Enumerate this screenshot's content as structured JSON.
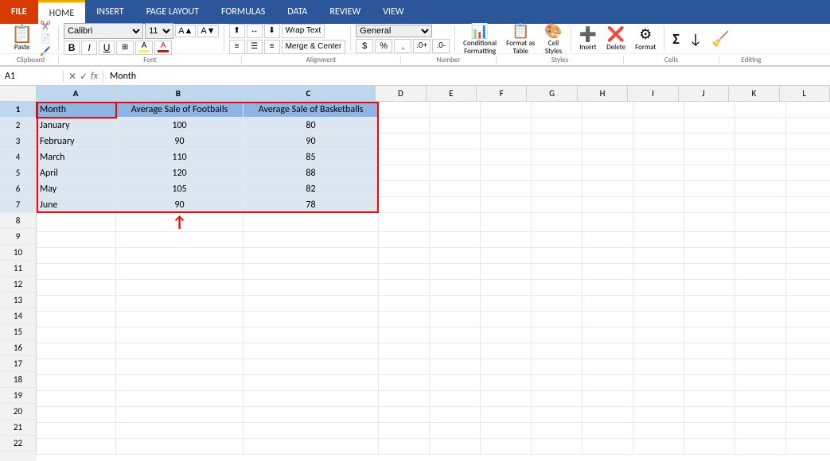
{
  "tabs": {
    "file": "FILE",
    "home": "HOME",
    "insert": "INSERT",
    "page_layout": "PAGE LAYOUT",
    "formulas": "FORMULAS",
    "data": "DATA",
    "review": "REVIEW",
    "view": "VIEW",
    "active": "HOME"
  },
  "toolbar": {
    "paste": "Paste",
    "clipboard_label": "Clipboard",
    "font_family": "Calibri",
    "font_size": "11",
    "font_label": "Font",
    "wrap_text": "Wrap Text",
    "merge_center": "Merge & Center",
    "alignment_label": "Alignment",
    "number_format": "General",
    "number_label": "Number",
    "conditional_formatting": "Conditional\nFormatting",
    "format_as_table": "Format as\nTable",
    "cell_styles": "Cell\nStyles",
    "styles_label": "Styles",
    "insert": "Insert",
    "delete": "Delete",
    "format": "Format",
    "cells_label": "Cells",
    "sum_label": "Σ",
    "fill_label": "Fill",
    "clear_label": "Clear",
    "editing_label": "Editing"
  },
  "formula_bar": {
    "cell_ref": "A1",
    "fx": "fx",
    "formula_value": "Month"
  },
  "columns": [
    "A",
    "B",
    "C",
    "D",
    "E",
    "F",
    "G",
    "H",
    "I",
    "J",
    "K",
    "L"
  ],
  "rows": [
    1,
    2,
    3,
    4,
    5,
    6,
    7,
    8,
    9,
    10,
    11,
    12,
    13,
    14,
    15,
    16,
    17,
    18,
    19,
    20,
    21,
    22
  ],
  "data": {
    "headers": [
      "Month",
      "Average Sale of Footballs",
      "Average Sale of Basketballs"
    ],
    "rows": [
      [
        "January",
        "100",
        "80"
      ],
      [
        "February",
        "90",
        "90"
      ],
      [
        "March",
        "110",
        "85"
      ],
      [
        "April",
        "120",
        "88"
      ],
      [
        "May",
        "105",
        "82"
      ],
      [
        "June",
        "90",
        "78"
      ]
    ]
  },
  "arrow": "↑"
}
